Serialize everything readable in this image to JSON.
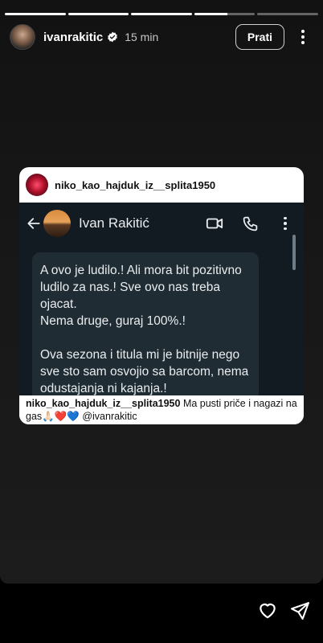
{
  "story": {
    "segments": [
      {
        "progress": 1
      },
      {
        "progress": 1
      },
      {
        "progress": 1
      },
      {
        "progress": 0.55
      },
      {
        "progress": 0
      }
    ]
  },
  "header": {
    "username": "ivanrakitic",
    "verified": true,
    "time": "15 min",
    "follow_label": "Prati",
    "more_icon": "more-vertical-icon"
  },
  "shared_post": {
    "username": "niko_kao_hajduk_iz__splita1950",
    "caption_user": "niko_kao_hajduk_iz__splita1950",
    "caption_text": " Ma pusti priče i nagazi na gas🙏🏻❤️💙 @ivanrakitic"
  },
  "chat": {
    "contact_name": "Ivan Rakitić",
    "icons": [
      "back-arrow-icon",
      "video-call-icon",
      "phone-icon",
      "more-vertical-icon"
    ],
    "message": "A ovo je ludilo.! Ali mora bit pozitivno ludilo za nas.! Sve ovo nas treba ojacat.\nNema druge, guraj 100%.!\n\nOva sezona i titula mi je bitnije nego sve sto sam osvojio sa barcom, nema odustajanja ni kajanja.!"
  },
  "footer": {
    "icons": [
      "heart-icon",
      "send-icon"
    ]
  },
  "colors": {
    "chat_bg": "#121b22",
    "bubble_bg": "#202c33",
    "chat_text": "#e9edef"
  }
}
